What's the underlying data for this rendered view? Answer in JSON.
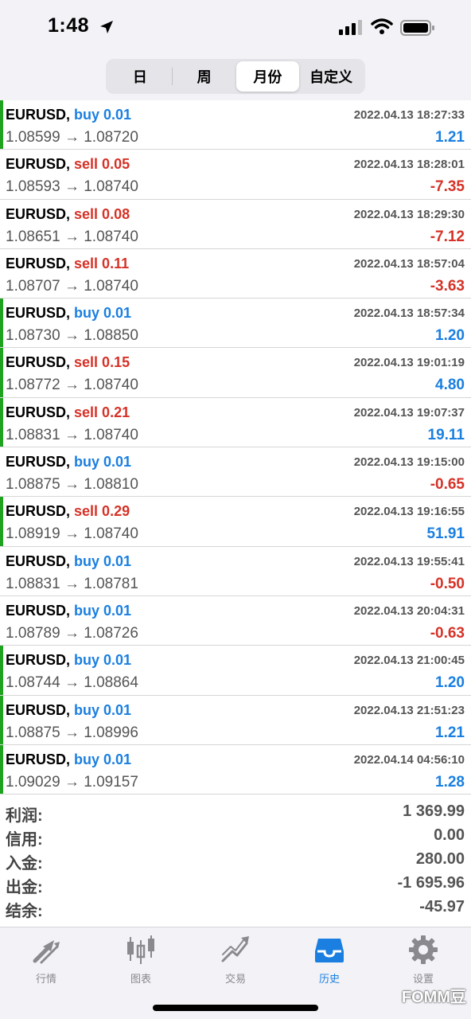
{
  "status_bar": {
    "time": "1:48"
  },
  "segments": {
    "items": [
      "日",
      "周",
      "月份",
      "自定义"
    ],
    "active": "月份"
  },
  "trades": [
    {
      "symbol": "EURUSD,",
      "side": "buy",
      "volume": "buy 0.01",
      "prices": "1.08599 → 1.08720",
      "time": "2022.04.13 18:27:33",
      "profit": "1.21",
      "win": true
    },
    {
      "symbol": "EURUSD,",
      "side": "sell",
      "volume": "sell 0.05",
      "prices": "1.08593 → 1.08740",
      "time": "2022.04.13 18:28:01",
      "profit": "-7.35",
      "win": false
    },
    {
      "symbol": "EURUSD,",
      "side": "sell",
      "volume": "sell 0.08",
      "prices": "1.08651 → 1.08740",
      "time": "2022.04.13 18:29:30",
      "profit": "-7.12",
      "win": false
    },
    {
      "symbol": "EURUSD,",
      "side": "sell",
      "volume": "sell 0.11",
      "prices": "1.08707 → 1.08740",
      "time": "2022.04.13 18:57:04",
      "profit": "-3.63",
      "win": false
    },
    {
      "symbol": "EURUSD,",
      "side": "buy",
      "volume": "buy 0.01",
      "prices": "1.08730 → 1.08850",
      "time": "2022.04.13 18:57:34",
      "profit": "1.20",
      "win": true
    },
    {
      "symbol": "EURUSD,",
      "side": "sell",
      "volume": "sell 0.15",
      "prices": "1.08772 → 1.08740",
      "time": "2022.04.13 19:01:19",
      "profit": "4.80",
      "win": true
    },
    {
      "symbol": "EURUSD,",
      "side": "sell",
      "volume": "sell 0.21",
      "prices": "1.08831 → 1.08740",
      "time": "2022.04.13 19:07:37",
      "profit": "19.11",
      "win": true
    },
    {
      "symbol": "EURUSD,",
      "side": "buy",
      "volume": "buy 0.01",
      "prices": "1.08875 → 1.08810",
      "time": "2022.04.13 19:15:00",
      "profit": "-0.65",
      "win": false
    },
    {
      "symbol": "EURUSD,",
      "side": "sell",
      "volume": "sell 0.29",
      "prices": "1.08919 → 1.08740",
      "time": "2022.04.13 19:16:55",
      "profit": "51.91",
      "win": true
    },
    {
      "symbol": "EURUSD,",
      "side": "buy",
      "volume": "buy 0.01",
      "prices": "1.08831 → 1.08781",
      "time": "2022.04.13 19:55:41",
      "profit": "-0.50",
      "win": false
    },
    {
      "symbol": "EURUSD,",
      "side": "buy",
      "volume": "buy 0.01",
      "prices": "1.08789 → 1.08726",
      "time": "2022.04.13 20:04:31",
      "profit": "-0.63",
      "win": false
    },
    {
      "symbol": "EURUSD,",
      "side": "buy",
      "volume": "buy 0.01",
      "prices": "1.08744 → 1.08864",
      "time": "2022.04.13 21:00:45",
      "profit": "1.20",
      "win": true
    },
    {
      "symbol": "EURUSD,",
      "side": "buy",
      "volume": "buy 0.01",
      "prices": "1.08875 → 1.08996",
      "time": "2022.04.13 21:51:23",
      "profit": "1.21",
      "win": true
    },
    {
      "symbol": "EURUSD,",
      "side": "buy",
      "volume": "buy 0.01",
      "prices": "1.09029 → 1.09157",
      "time": "2022.04.14 04:56:10",
      "profit": "1.28",
      "win": true
    }
  ],
  "summary": [
    {
      "label": "利润:",
      "value": "1 369.99"
    },
    {
      "label": "信用:",
      "value": "0.00"
    },
    {
      "label": "入金:",
      "value": "280.00"
    },
    {
      "label": "出金:",
      "value": "-1 695.96"
    },
    {
      "label": "结余:",
      "value": "-45.97"
    }
  ],
  "tabbar": {
    "items": [
      {
        "label": "行情",
        "icon": "quotes-arrows-icon"
      },
      {
        "label": "图表",
        "icon": "candlestick-chart-icon"
      },
      {
        "label": "交易",
        "icon": "trade-trend-icon"
      },
      {
        "label": "历史",
        "icon": "history-inbox-icon"
      },
      {
        "label": "设置",
        "icon": "gear-icon"
      }
    ],
    "active": "历史"
  },
  "colors": {
    "buy": "#1a7fe0",
    "sell": "#d63227",
    "win_bar": "#1fa31f"
  },
  "watermark": "FOMM豆"
}
